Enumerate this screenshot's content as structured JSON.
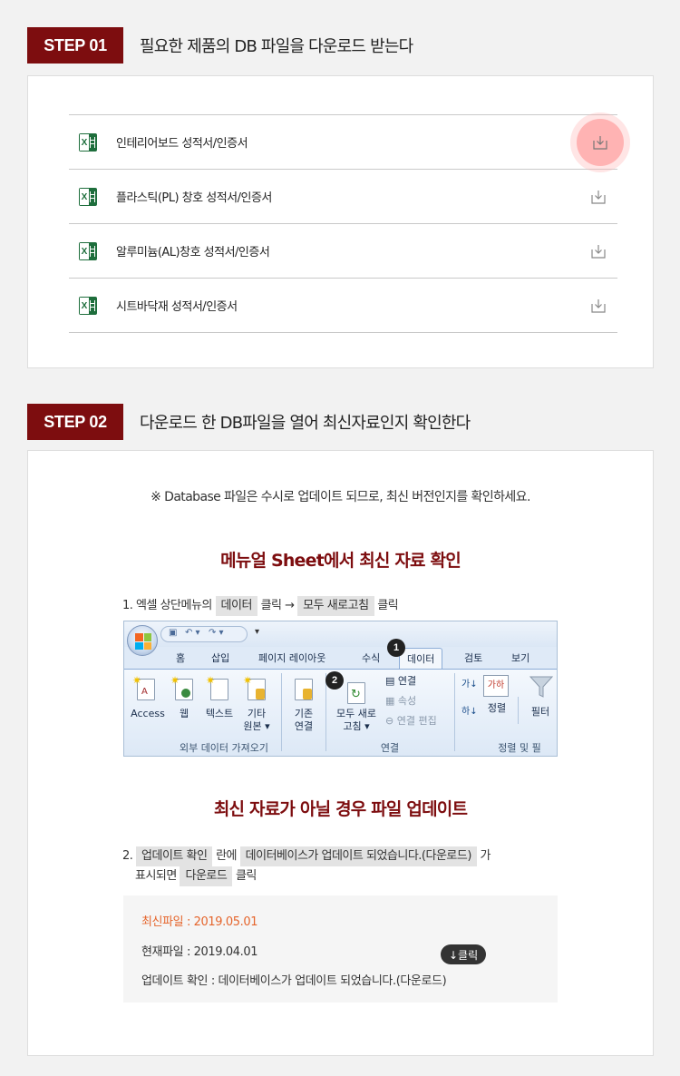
{
  "step1": {
    "badge": "STEP 01",
    "title": "필요한 제품의 DB 파일을 다운로드 받는다",
    "files": [
      {
        "name": "인테리어보드 성적서/인증서"
      },
      {
        "name": "플라스틱(PL) 창호 성적서/인증서"
      },
      {
        "name": "알루미늄(AL)창호 성적서/인증서"
      },
      {
        "name": "시트바닥재 성적서/인증서"
      }
    ]
  },
  "step2": {
    "badge": "STEP 02",
    "title": "다운로드 한 DB파일을 열어 최신자료인지 확인한다",
    "notice": "※ Database 파일은 수시로 업데이트 되므로, 최신 버전인지를 확인하세요.",
    "section1_title": "메뉴얼 Sheet에서 최신 자료 확인",
    "instr1": {
      "prefix": "1. 엑셀 상단메뉴의",
      "tag1": "데이터",
      "mid": "클릭 →",
      "tag2": "모두 새로고침",
      "suffix": "클릭"
    },
    "ribbon": {
      "tabs": [
        "홈",
        "삽입",
        "페이지 레이아웃",
        "수식",
        "데이터",
        "검토",
        "보기"
      ],
      "buttons": [
        "Access",
        "웹",
        "텍스트",
        "기타",
        "원본 ▾",
        "기존",
        "연결",
        "모두 새로",
        "고침 ▾",
        "연결",
        "속성",
        "연결 편집",
        "정렬",
        "필터"
      ],
      "groups": [
        "외부 데이터 가져오기",
        "연결",
        "정렬 및 필"
      ],
      "sort_icons": [
        "가↓",
        "하↓",
        "가하"
      ],
      "markers": [
        "1",
        "2"
      ]
    },
    "section2_title": "최신 자료가 아닐 경우 파일 업데이트",
    "instr2": {
      "prefix": "2.",
      "tag1": "업데이트 확인",
      "mid": "란에",
      "tag2": "데이터베이스가 업데이트 되었습니다.(다운로드)",
      "suffix": "가",
      "line2_prefix": "표시되면",
      "tag3": "다운로드",
      "line2_suffix": "클릭"
    },
    "update_box": {
      "latest": "최신파일 : 2019.05.01",
      "current": "현재파일 : 2019.04.01",
      "click": "↓클릭",
      "status": "업데이트 확인 : 데이터베이스가 업데이트 되었습니다.(다운로드)"
    }
  },
  "colors": {
    "brand": "#7d0d0f",
    "highlight": "#e5652c",
    "excel": "#1e6e3c"
  }
}
